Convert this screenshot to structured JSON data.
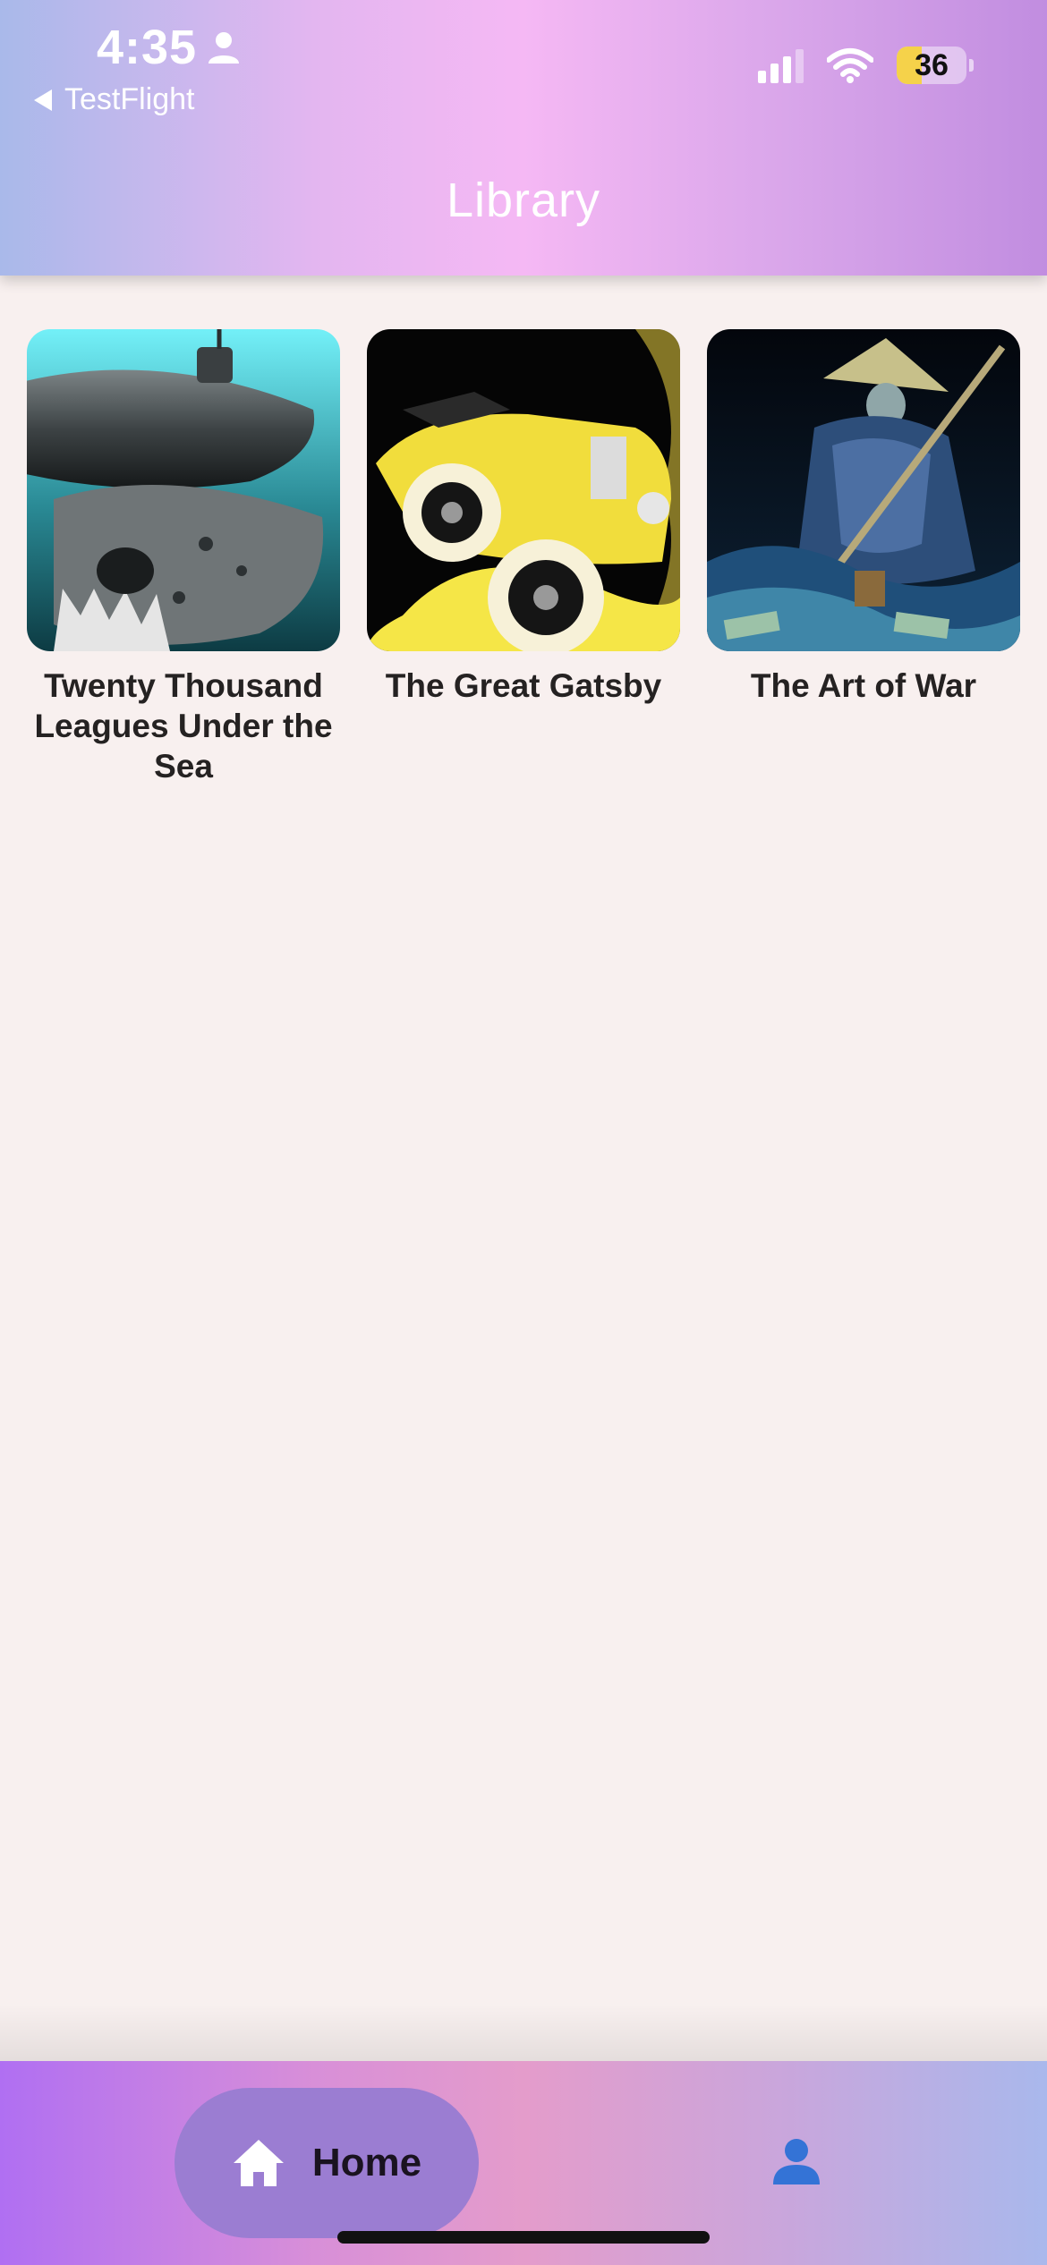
{
  "status_bar": {
    "time": "4:35",
    "back_app": "TestFlight",
    "battery": "36",
    "battery_level": 0.36,
    "icons": [
      "person-icon",
      "signal-icon",
      "wifi-icon",
      "battery-icon"
    ]
  },
  "header": {
    "title": "Library"
  },
  "books": [
    {
      "title": "Twenty Thousand Leagues Under the Sea",
      "cover_icon": "submarine-cover"
    },
    {
      "title": "The Great Gatsby",
      "cover_icon": "vintage-car-cover"
    },
    {
      "title": "The Art of War",
      "cover_icon": "samurai-cover"
    }
  ],
  "bottom_nav": {
    "home_label": "Home",
    "items": [
      "home-icon",
      "profile-icon"
    ]
  },
  "colors": {
    "background": "#f8f0ef",
    "accent_blue": "#3473d6",
    "home_pill": "#9b7dd2"
  }
}
